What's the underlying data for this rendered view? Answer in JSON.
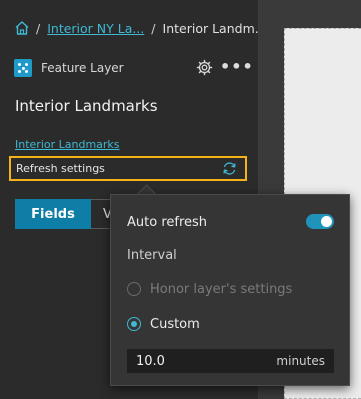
{
  "breadcrumb": {
    "separator": "/",
    "parent_link": "Interior NY La...",
    "current": "Interior Landm..."
  },
  "item": {
    "type_label": "Feature Layer",
    "title": "Interior Landmarks",
    "source_link": "Interior Landmarks"
  },
  "refresh": {
    "label": "Refresh settings"
  },
  "tabs": {
    "fields": "Fields",
    "second": "V"
  },
  "popover": {
    "auto_refresh_label": "Auto refresh",
    "auto_refresh_enabled": true,
    "interval_label": "Interval",
    "options": [
      {
        "label": "Honor layer's settings",
        "selected": false,
        "disabled": true
      },
      {
        "label": "Custom",
        "selected": true,
        "disabled": false
      }
    ],
    "interval_value": "10.0",
    "interval_unit": "minutes"
  },
  "colors": {
    "accent": "#3fb9d4",
    "primary_button": "#0f7ea6",
    "highlight": "#f2b418",
    "panel_bg": "#2b2b2b"
  },
  "icons": {
    "home": "home-icon",
    "layer": "feature-layer-icon",
    "settings": "gear-icon",
    "more": "more-options-icon",
    "refresh": "refresh-icon"
  }
}
